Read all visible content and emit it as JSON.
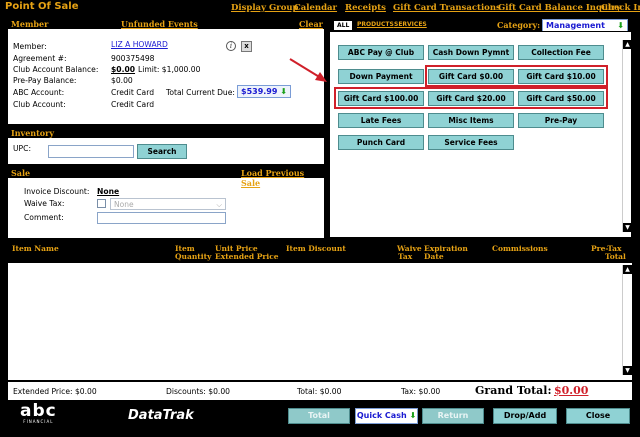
{
  "header": {
    "title": "Point Of Sale",
    "links": [
      "Display Group",
      "Calendar",
      "Receipts",
      "Gift Card Transactions",
      "Gift Card Balance Inquiry",
      "Check In"
    ]
  },
  "member": {
    "heading": "Member",
    "unfunded_events": "Unfunded Events",
    "clear": "Clear",
    "member_label": "Member:",
    "member_name": "LIZ A HOWARD",
    "info_glyph": "i",
    "x_label": "x",
    "agreement_label": "Agreement #:",
    "agreement_value": "900375498",
    "balance_label": "Club Account Balance:",
    "balance_value": "$0.00",
    "limit_text": "Limit: $1,000.00",
    "prepay_label": "Pre-Pay Balance:",
    "prepay_value": "$0.00",
    "abc_label": "ABC Account:",
    "abc_value": "Credit Card",
    "due_label": "Total Current Due:",
    "due_value": "$539.99",
    "club_label": "Club Account:",
    "club_value": "Credit Card"
  },
  "inventory": {
    "heading": "Inventory",
    "upc_label": "UPC:",
    "upc_value": "",
    "search_label": "Search"
  },
  "sale": {
    "heading": "Sale",
    "load_previous": "Load Previous Sale",
    "invoice_label": "Invoice Discount:",
    "invoice_value": "None",
    "waive_label": "Waive Tax:",
    "waive_select": "None",
    "comment_label": "Comment:",
    "comment_value": ""
  },
  "catalog": {
    "tabs": [
      "ALL",
      "PRODUCTS",
      "SERVICES"
    ],
    "category_label": "Category:",
    "category_value": "Management",
    "items": [
      "ABC Pay @ Club",
      "Cash Down Pymnt",
      "Collection Fee",
      "Down Payment",
      "Gift Card $0.00",
      "Gift Card $10.00",
      "Gift Card $100.00",
      "Gift Card $20.00",
      "Gift Card $50.00",
      "Late Fees",
      "Misc Items",
      "Pre-Pay",
      "Punch Card",
      "Service Fees"
    ]
  },
  "grid": {
    "columns": {
      "item_name": "Item Name",
      "item": "Item",
      "quantity": "Quantity",
      "unit_price": "Unit Price",
      "extended_price": "Extended Price",
      "item_discount": "Item Discount",
      "waive": "Waive",
      "tax": "Tax",
      "expiration": "Expiration",
      "date": "Date",
      "commissions": "Commissions",
      "pretax": "Pre-Tax",
      "total": "Total"
    }
  },
  "totals": {
    "extended": "Extended Price: $0.00",
    "discounts": "Discounts: $0.00",
    "total": "Total: $0.00",
    "tax": "Tax: $0.00",
    "grand_label": "Grand Total:",
    "grand_value": "$0.00"
  },
  "footer": {
    "abc_logo": "abc",
    "abc_sub": "FINANCIAL",
    "datatrak_logo": "DataTrak",
    "total": "Total",
    "quick_cash": "Quick Cash",
    "return": "Return",
    "drop_add": "Drop/Add",
    "close": "Close"
  },
  "colors": {
    "accent": "#e6a214",
    "button": "#8fd2d4",
    "highlight": "#d0202a",
    "link": "#1a1ad1"
  }
}
